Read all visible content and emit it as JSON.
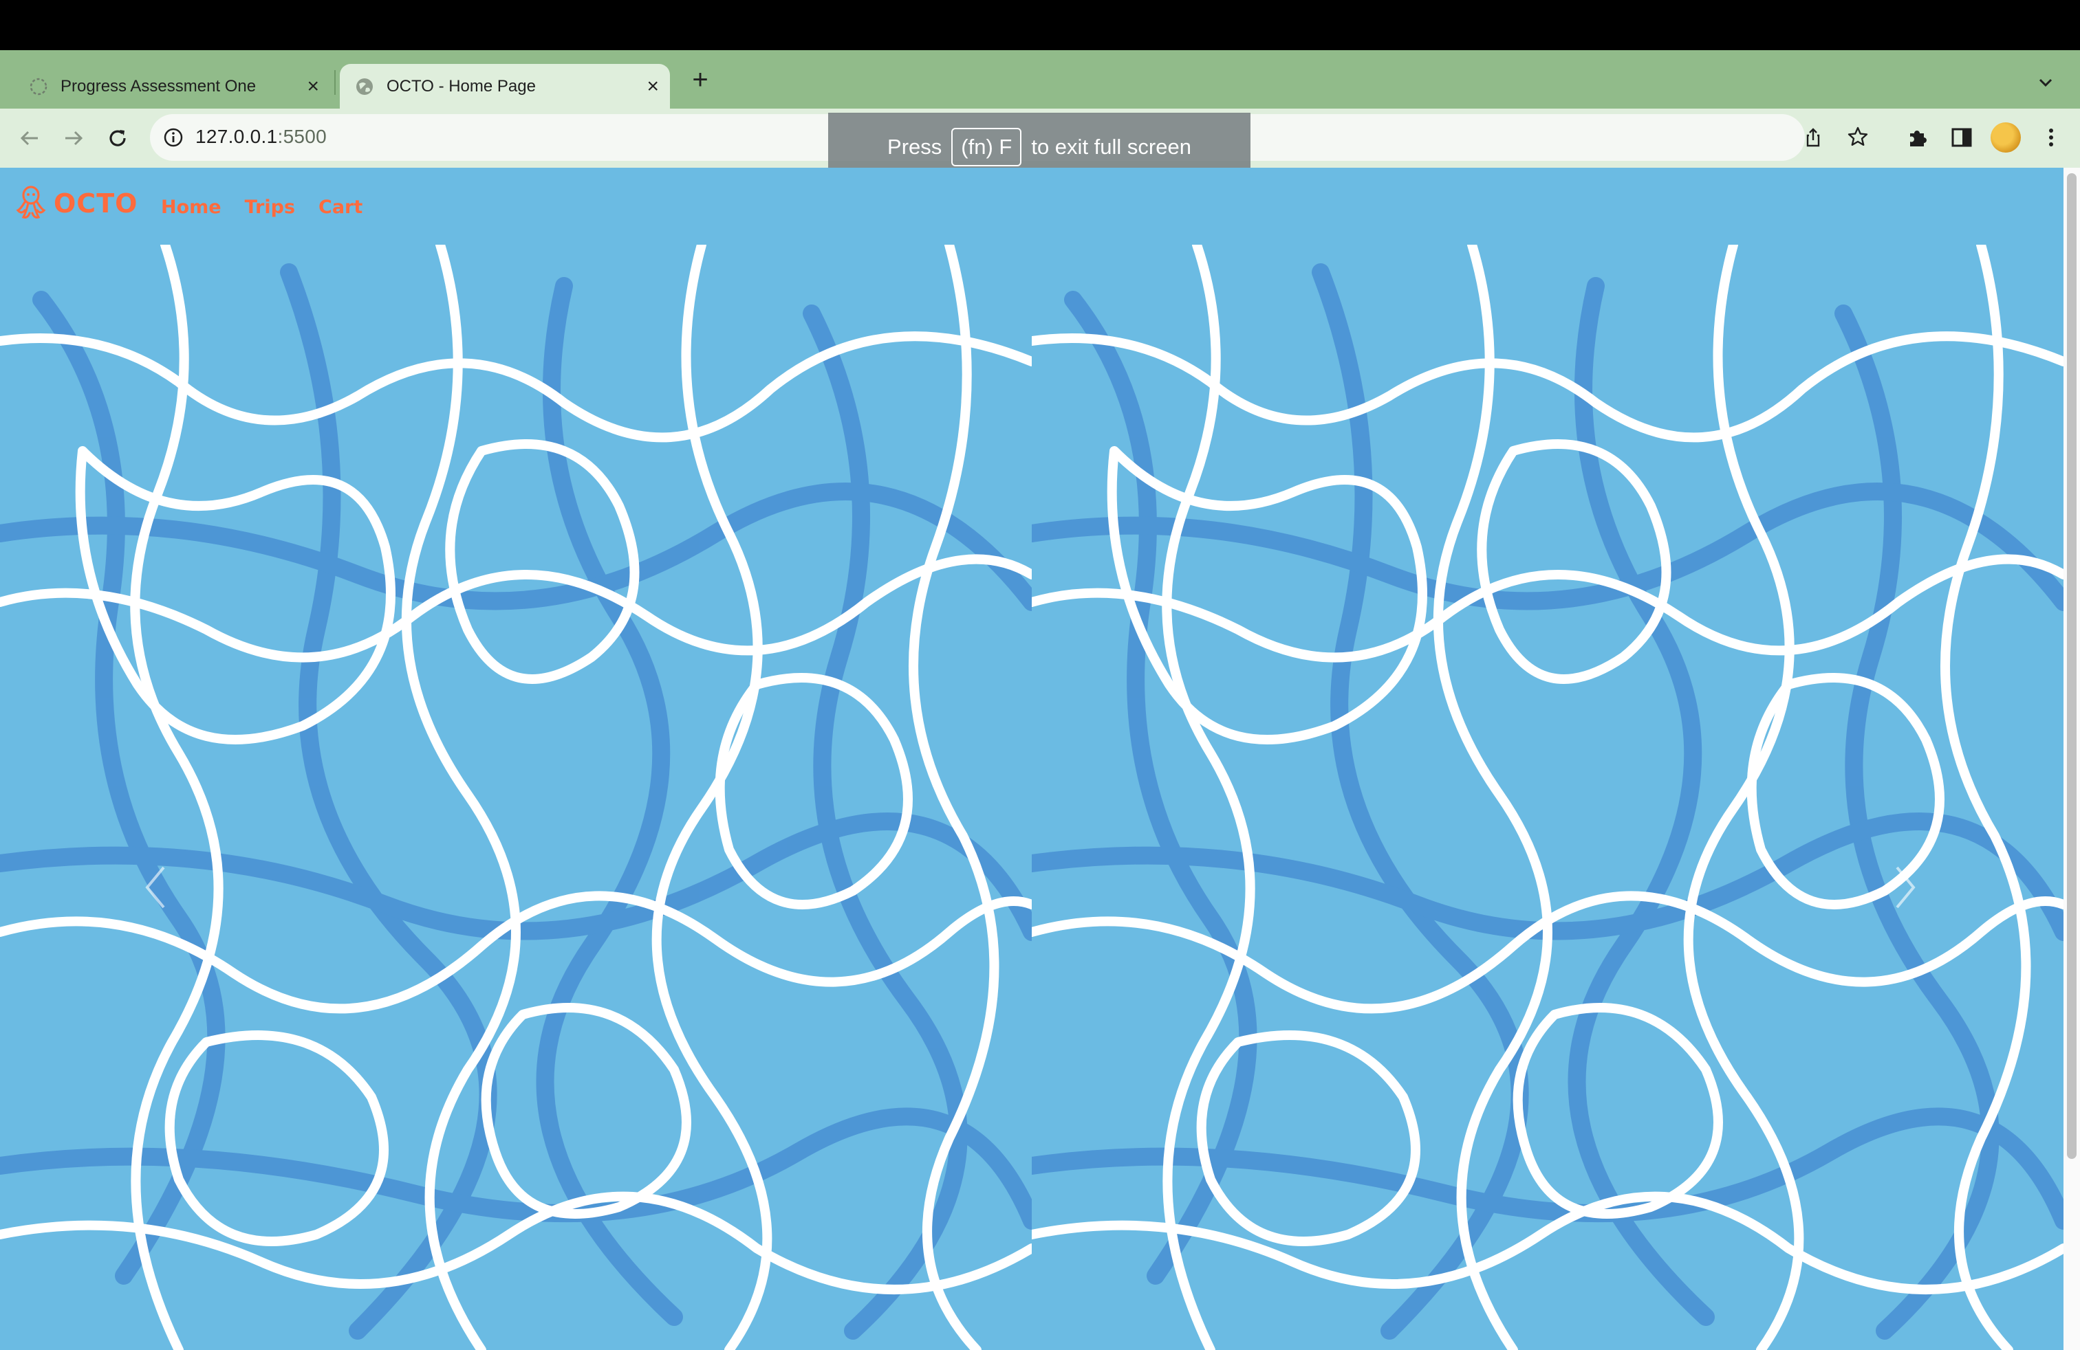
{
  "browser": {
    "tabs": [
      {
        "title": "Progress Assessment One",
        "active": false
      },
      {
        "title": "OCTO - Home Page",
        "active": true
      }
    ],
    "url_host": "127.0.0.1",
    "url_port": ":5500",
    "fullscreen_notice": {
      "press": "Press",
      "key": "(fn) F",
      "suffix": "to exit full screen"
    }
  },
  "site": {
    "brand": "OCTO",
    "nav": [
      "Home",
      "Trips",
      "Cart"
    ]
  },
  "colors": {
    "page_bg": "#6bbbe3",
    "water_dark": "#4a92d4",
    "caustic_white": "#ffffff",
    "brand_orange": "#ff6b3d",
    "tab_strip": "#91bb8a",
    "toolbar": "#dfeedc"
  },
  "icons": [
    "loading-icon",
    "globe-icon",
    "close-icon",
    "plus-icon",
    "chevron-down-icon",
    "back-icon",
    "forward-icon",
    "reload-icon",
    "info-icon",
    "share-icon",
    "star-icon",
    "extensions-icon",
    "sidepanel-icon",
    "avatar",
    "menu-icon",
    "octopus-icon",
    "chevron-left-icon",
    "chevron-right-icon"
  ]
}
